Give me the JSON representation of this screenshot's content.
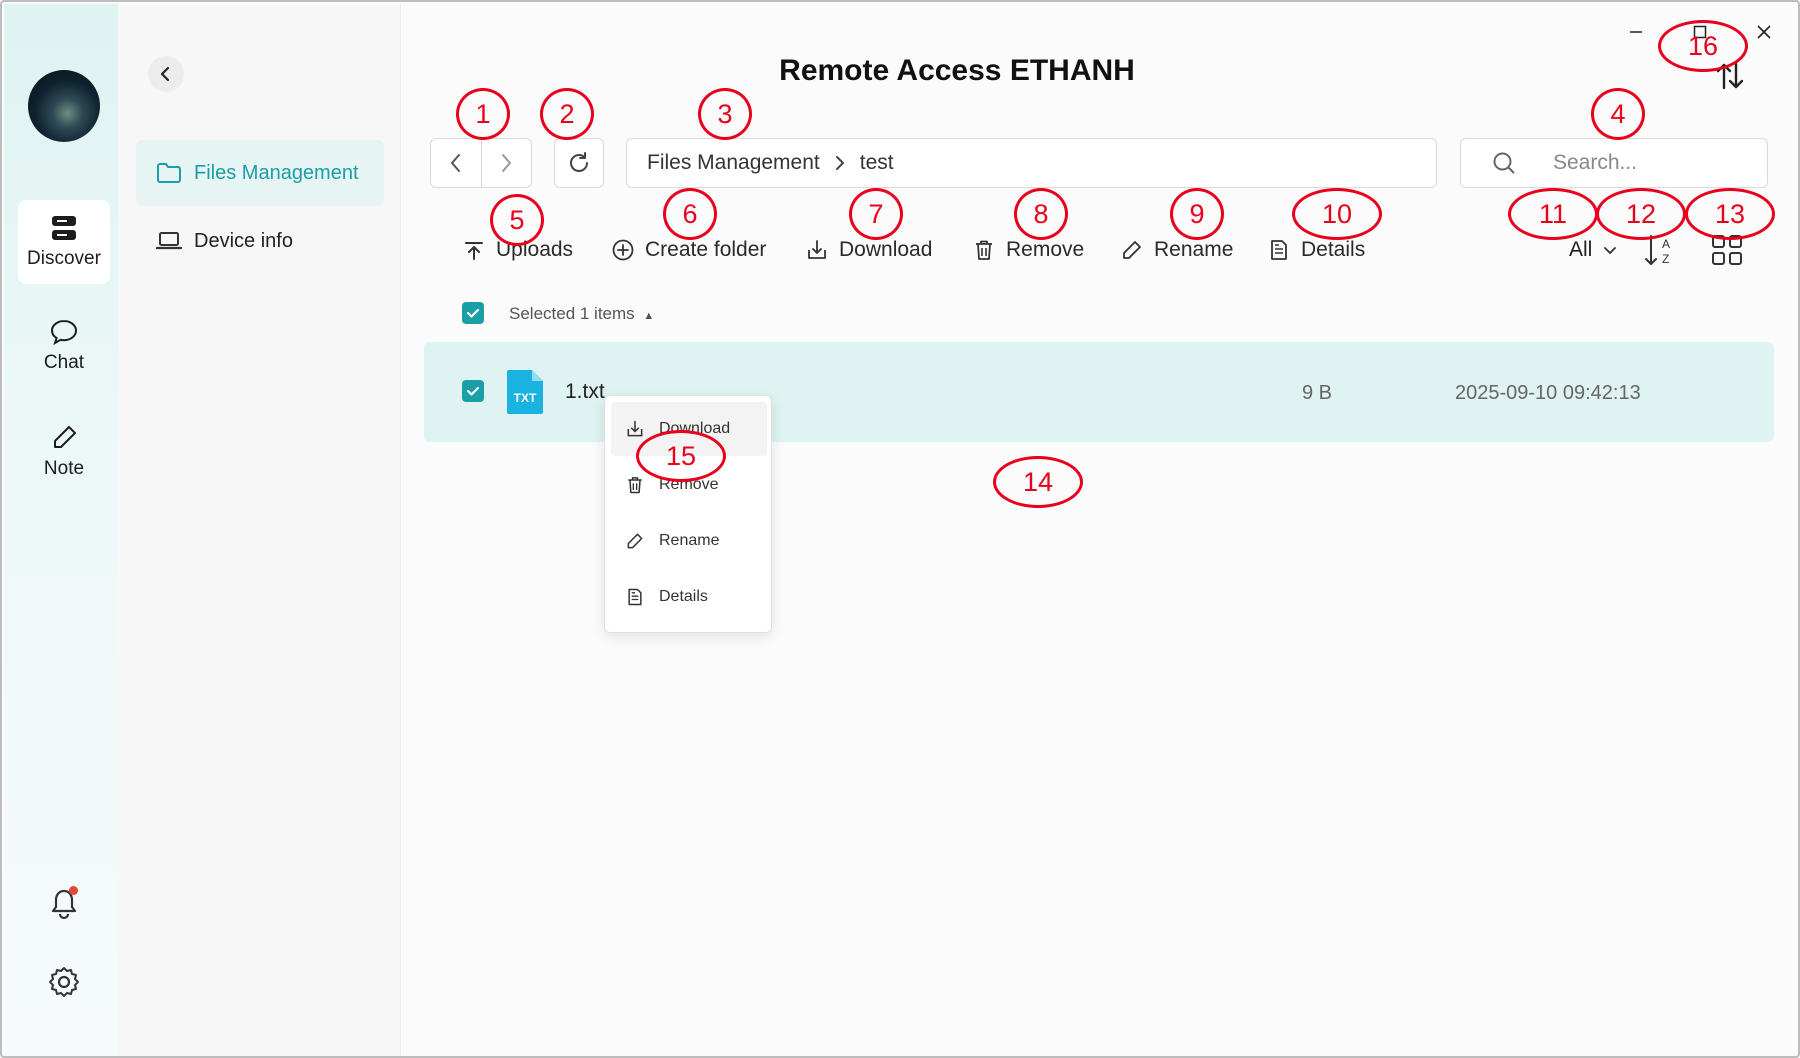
{
  "window": {
    "title": "Remote Access ETHANH"
  },
  "rail": {
    "items": [
      {
        "label": "Discover",
        "icon": "discover-icon"
      },
      {
        "label": "Chat",
        "icon": "chat-icon"
      },
      {
        "label": "Note",
        "icon": "note-icon"
      }
    ],
    "bottom_icons": [
      "bell-icon",
      "gear-icon"
    ]
  },
  "sidebar": {
    "items": [
      {
        "label": "Files Management",
        "icon": "folder-icon"
      },
      {
        "label": "Device info",
        "icon": "laptop-icon"
      }
    ]
  },
  "breadcrumb": {
    "root": "Files Management",
    "current": "test"
  },
  "search": {
    "placeholder": "Search..."
  },
  "toolbar": {
    "uploads": "Uploads",
    "create_folder": "Create folder",
    "download": "Download",
    "remove": "Remove",
    "rename": "Rename",
    "details": "Details",
    "filter": "All"
  },
  "selection": {
    "label": "Selected 1 items"
  },
  "files": [
    {
      "name": "1.txt",
      "type_badge": "TXT",
      "size": "9 B",
      "modified": "2025-09-10 09:42:13",
      "selected": true
    }
  ],
  "context_menu": {
    "items": [
      {
        "label": "Download",
        "icon": "download-icon"
      },
      {
        "label": "Remove",
        "icon": "trash-icon"
      },
      {
        "label": "Rename",
        "icon": "pencil-icon"
      },
      {
        "label": "Details",
        "icon": "document-icon"
      }
    ]
  },
  "annotations": [
    "1",
    "2",
    "3",
    "4",
    "5",
    "6",
    "7",
    "8",
    "9",
    "10",
    "11",
    "12",
    "13",
    "14",
    "15",
    "16"
  ],
  "colors": {
    "accent": "#1a9ea8",
    "selected_row": "#def3f2",
    "annotation": "#e8001c"
  }
}
